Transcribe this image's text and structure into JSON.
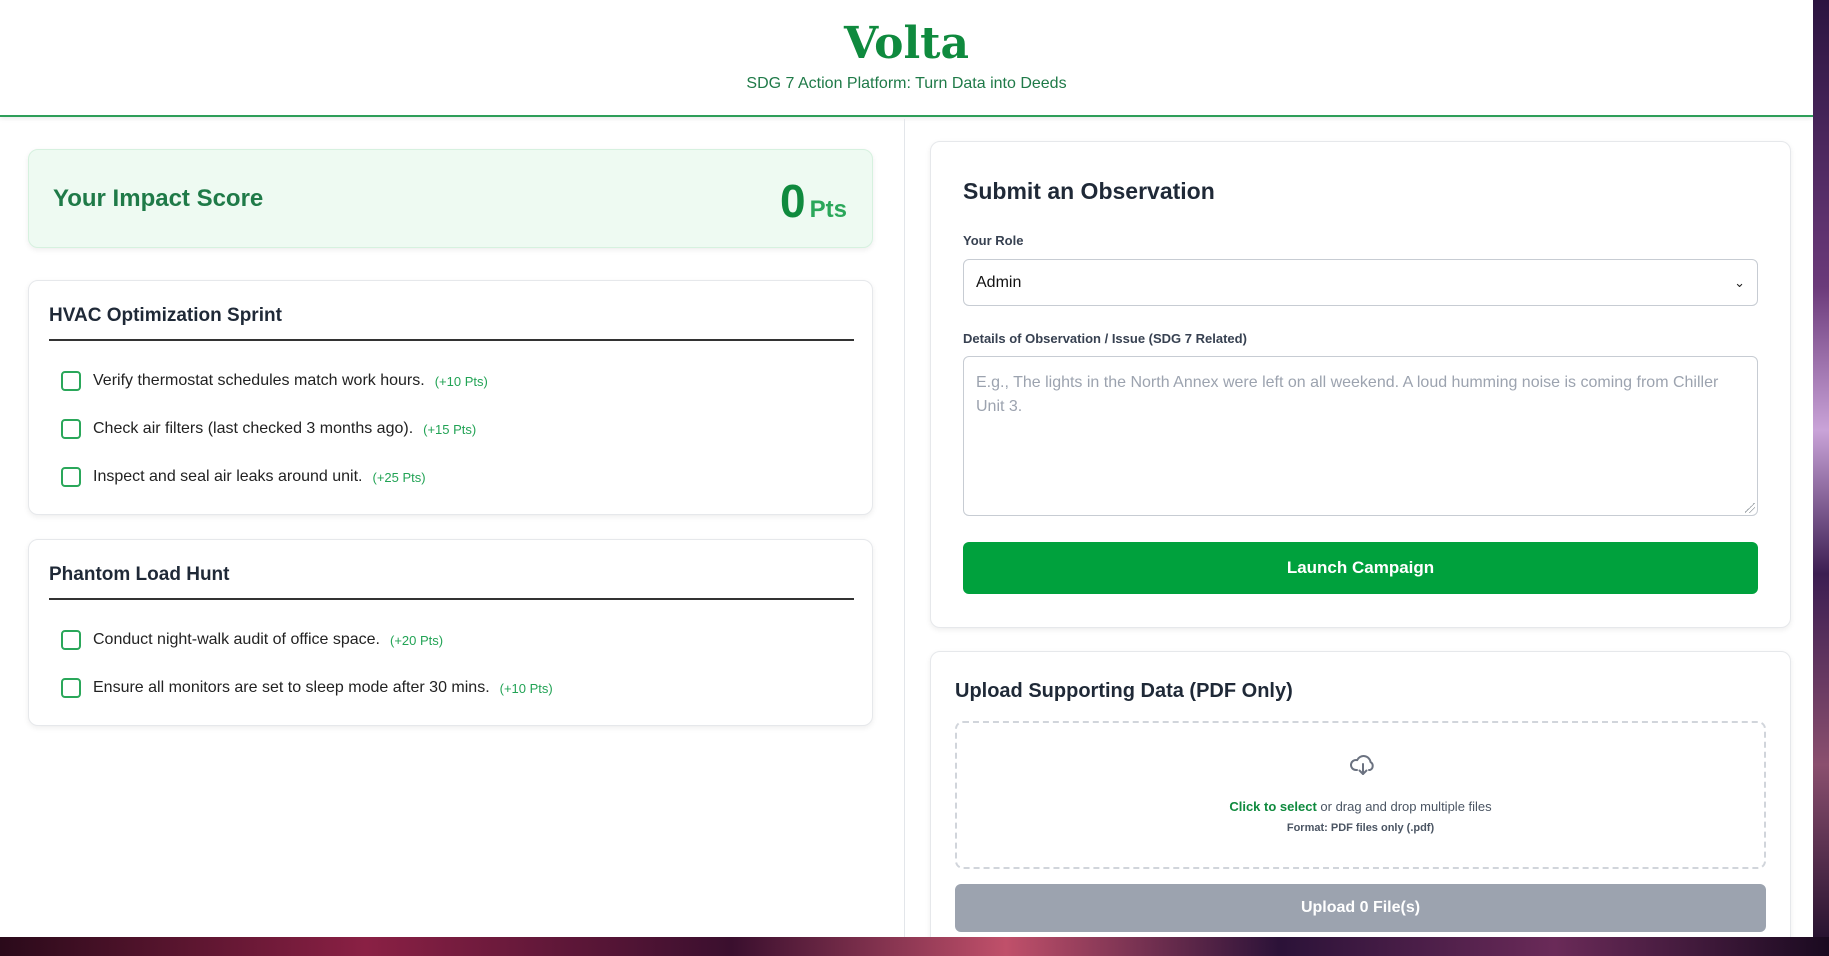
{
  "app": {
    "title": "Volta",
    "tagline": "SDG 7 Action Platform: Turn Data into Deeds"
  },
  "score": {
    "label": "Your Impact Score",
    "value": "0",
    "unit": "Pts"
  },
  "missions": [
    {
      "title": "HVAC Optimization Sprint",
      "tasks": [
        {
          "label": "Verify thermostat schedules match work hours.",
          "points": "(+10 Pts)",
          "checked": false
        },
        {
          "label": "Check air filters (last checked 3 months ago).",
          "points": "(+15 Pts)",
          "checked": false
        },
        {
          "label": "Inspect and seal air leaks around unit.",
          "points": "(+25 Pts)",
          "checked": false
        }
      ]
    },
    {
      "title": "Phantom Load Hunt",
      "tasks": [
        {
          "label": "Conduct night-walk audit of office space.",
          "points": "(+20 Pts)",
          "checked": false
        },
        {
          "label": "Ensure all monitors are set to sleep mode after 30 mins.",
          "points": "(+10 Pts)",
          "checked": false
        }
      ]
    }
  ],
  "observation": {
    "title": "Submit an Observation",
    "role_label": "Your Role",
    "role_value": "Admin",
    "details_label": "Details of Observation / Issue (SDG 7 Related)",
    "details_placeholder": "E.g., The lights in the North Annex were left on all weekend. A loud humming noise is coming from Chiller Unit 3.",
    "submit_label": "Launch Campaign"
  },
  "upload": {
    "title": "Upload Supporting Data (PDF Only)",
    "click_text": "Click to select",
    "drag_text": " or drag and drop multiple files",
    "format_text": "Format: PDF files only (.pdf)",
    "button_label": "Upload 0 File(s)"
  },
  "colors": {
    "brand": "#0f8a3e",
    "primary_button": "#00a13d",
    "disabled_button": "#9ca3af",
    "score_bg": "#eefaf2"
  },
  "icons": {
    "upload": "cloud-download-icon",
    "select": "chevron-down-icon"
  }
}
